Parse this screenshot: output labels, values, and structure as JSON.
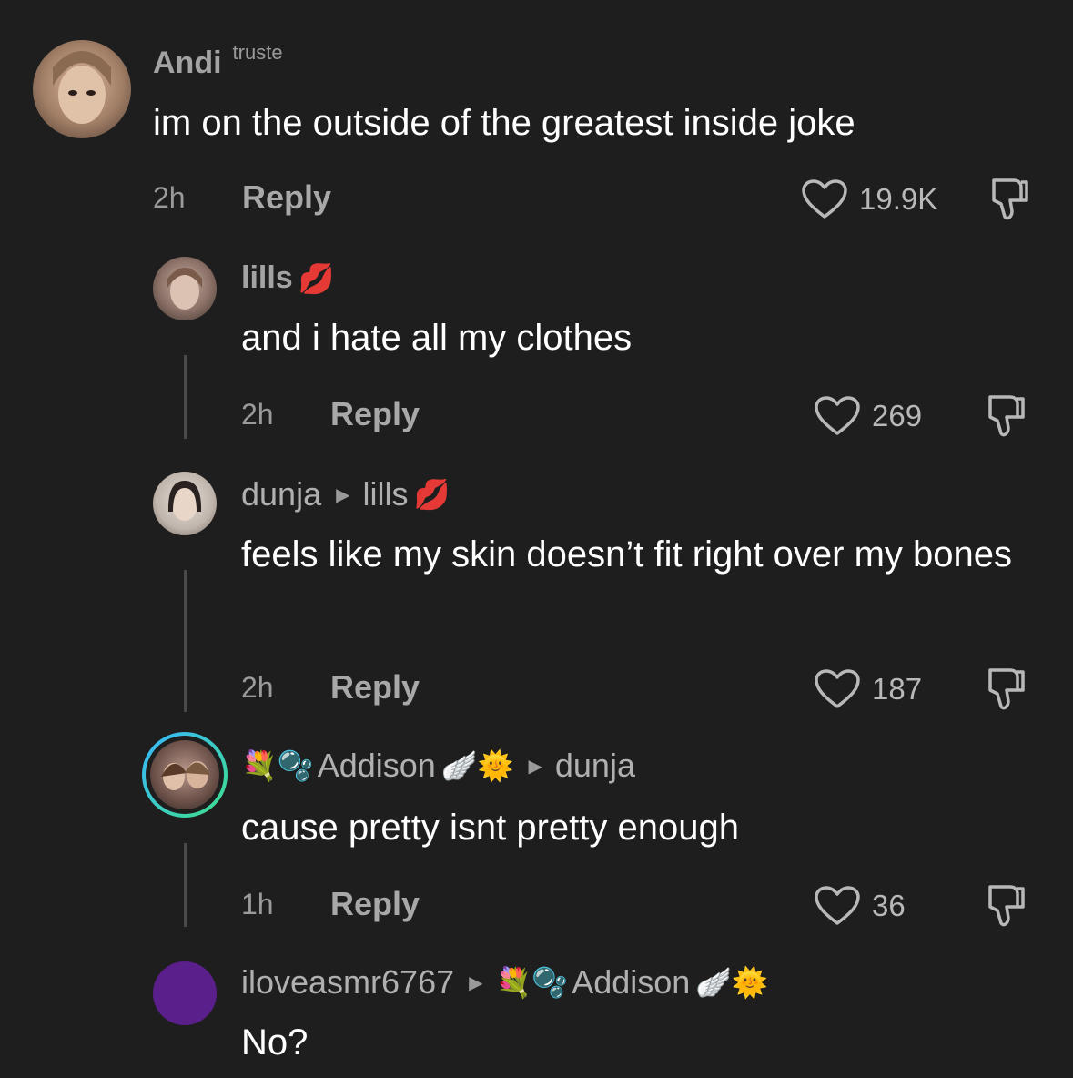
{
  "comments": [
    {
      "username": "Andi",
      "tag": "truste",
      "text": "im on the outside of the greatest inside joke",
      "time": "2h",
      "reply_label": "Reply",
      "likes": "19.9K",
      "avatar_colors": [
        "#c9a88e",
        "#6b4e3d"
      ]
    },
    {
      "username": "lills",
      "name_emoji": "💋",
      "text": "and i hate all my clothes",
      "time": "2h",
      "reply_label": "Reply",
      "likes": "269",
      "avatar_colors": [
        "#b8a39a",
        "#5a4a44"
      ]
    },
    {
      "username": "dunja",
      "reply_to": "lills",
      "reply_to_emoji": "💋",
      "text": "feels like my skin doesn’t fit right over my bones",
      "time": "2h",
      "reply_label": "Reply",
      "likes": "187",
      "avatar_colors": [
        "#d8d0c8",
        "#3a2f2c"
      ]
    },
    {
      "username": "Addison",
      "name_prefix": "💐🫧",
      "name_suffix": "🪽🌞",
      "reply_to": "dunja",
      "text": "cause pretty isnt pretty enough",
      "time": "1h",
      "reply_label": "Reply",
      "likes": "36",
      "avatar_colors": [
        "#a88a7a",
        "#2a2a2a"
      ]
    },
    {
      "username": "iloveasmr6767",
      "reply_to": "Addison",
      "reply_to_prefix": "💐🫧",
      "reply_to_suffix": "🪽🌞",
      "text": "No?",
      "avatar_colors": [
        "#5a1f8a"
      ]
    }
  ],
  "colors": {
    "background": "#1e1e1e",
    "text": "#ffffff",
    "muted": "#9a9a9a",
    "story_ring_start": "#38b6ff",
    "story_ring_end": "#3ee08a"
  }
}
